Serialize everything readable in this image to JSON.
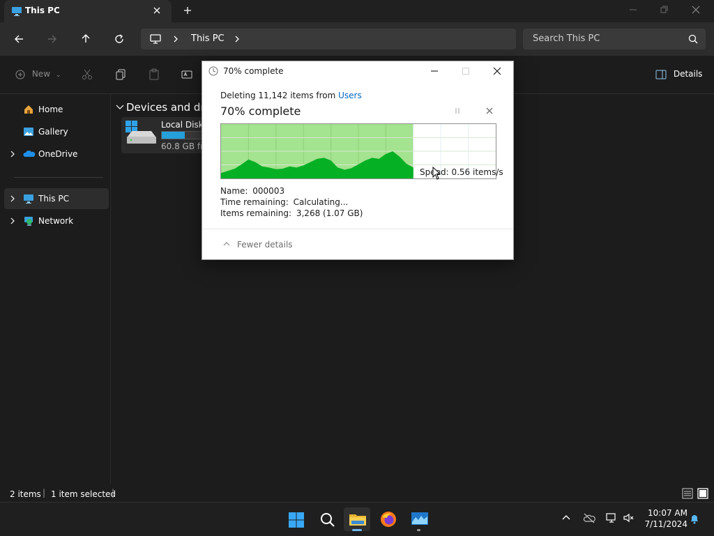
{
  "window": {
    "tab_title": "This PC",
    "address_location": "This PC",
    "search_placeholder": "Search This PC",
    "toolbar_new_label": "New",
    "details_label": "Details"
  },
  "sidebar": {
    "items": [
      {
        "label": "Home",
        "icon": "home-icon"
      },
      {
        "label": "Gallery",
        "icon": "gallery-icon"
      },
      {
        "label": "OneDrive",
        "icon": "onedrive-icon"
      },
      {
        "label": "This PC",
        "icon": "this-pc-icon"
      },
      {
        "label": "Network",
        "icon": "network-icon"
      }
    ]
  },
  "content": {
    "group_title": "Devices and drives",
    "drive": {
      "name": "Local Disk (C:)",
      "free": "60.8 GB free",
      "used_fraction": 0.55
    }
  },
  "status": {
    "items_count": "2 items",
    "selected": "1 item selected"
  },
  "dialog": {
    "title": "70% complete",
    "line_prefix": "Deleting 11,142 items from ",
    "line_link": "Users",
    "percent_text": "70% complete",
    "progress_fraction": 0.7,
    "speed": "Speed: 0.56 items/s",
    "name_label": "Name:",
    "name_value": "000003",
    "time_label": "Time remaining:",
    "time_value": "Calculating...",
    "items_label": "Items remaining:",
    "items_value": "3,268 (1.07 GB)",
    "fewer_details": "Fewer details"
  },
  "taskbar": {
    "time": "10:07 AM",
    "date": "7/11/2024"
  },
  "colors": {
    "accent": "#26a0da",
    "progress_fill": "#a4e38f",
    "speed_graph": "#06b025",
    "link": "#0067c0"
  }
}
